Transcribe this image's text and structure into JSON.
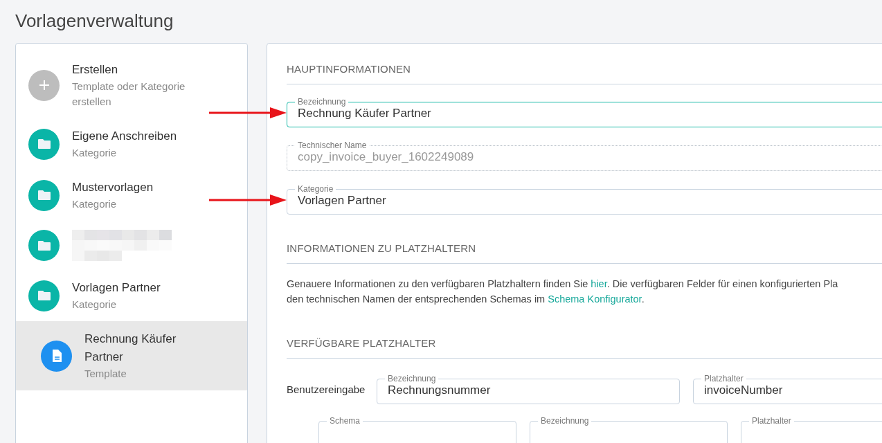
{
  "page_title": "Vorlagenverwaltung",
  "sidebar": {
    "items": [
      {
        "kind": "create",
        "title": "Erstellen",
        "subtitle": "Template oder Kategorie erstellen",
        "selected": false
      },
      {
        "kind": "category",
        "title": "Eigene Anschreiben",
        "subtitle": "Kategorie",
        "selected": false
      },
      {
        "kind": "category",
        "title": "Mustervorlagen",
        "subtitle": "Kategorie",
        "selected": false
      },
      {
        "kind": "redacted",
        "selected": false
      },
      {
        "kind": "category",
        "title": "Vorlagen Partner",
        "subtitle": "Kategorie",
        "selected": false,
        "children": [
          {
            "kind": "template",
            "title": "Rechnung Käufer Partner",
            "subtitle": "Template",
            "selected": true
          }
        ]
      }
    ]
  },
  "main_info": {
    "heading": "HAUPTINFORMATIONEN",
    "fields": [
      {
        "label": "Bezeichnung",
        "value": "Rechnung Käufer Partner",
        "focused": true,
        "disabled": false,
        "marked": true
      },
      {
        "label": "Technischer Name",
        "value": "copy_invoice_buyer_1602249089",
        "focused": false,
        "disabled": true,
        "marked": false
      },
      {
        "label": "Kategorie",
        "value": "Vorlagen Partner",
        "focused": false,
        "disabled": false,
        "marked": true
      }
    ]
  },
  "placeholder_info": {
    "heading": "INFORMATIONEN ZU PLATZHALTERN",
    "paragraph": [
      {
        "kind": "text",
        "text": "Genauere Informationen zu den verfügbaren Platzhaltern finden Sie "
      },
      {
        "kind": "link",
        "text": "hier"
      },
      {
        "kind": "text",
        "text": ". Die verfügbaren Felder für einen konfigurierten Pla"
      },
      {
        "kind": "break"
      },
      {
        "kind": "text",
        "text": "den technischen Namen der entsprechenden Schemas im "
      },
      {
        "kind": "link",
        "text": "Schema Konfigurator"
      },
      {
        "kind": "text",
        "text": "."
      }
    ]
  },
  "available_placeholders": {
    "heading": "VERFÜGBARE PLATZHALTER",
    "rows": [
      {
        "label": "Benutzereingabe",
        "fields": [
          {
            "label": "Bezeichnung",
            "value": "Rechnungsnummer"
          },
          {
            "label": "Platzhalter",
            "value": "invoiceNumber"
          }
        ]
      },
      {
        "fields": [
          {
            "label": "Schema"
          },
          {
            "label": "Bezeichnung"
          },
          {
            "label": "Platzhalter"
          }
        ]
      }
    ]
  }
}
